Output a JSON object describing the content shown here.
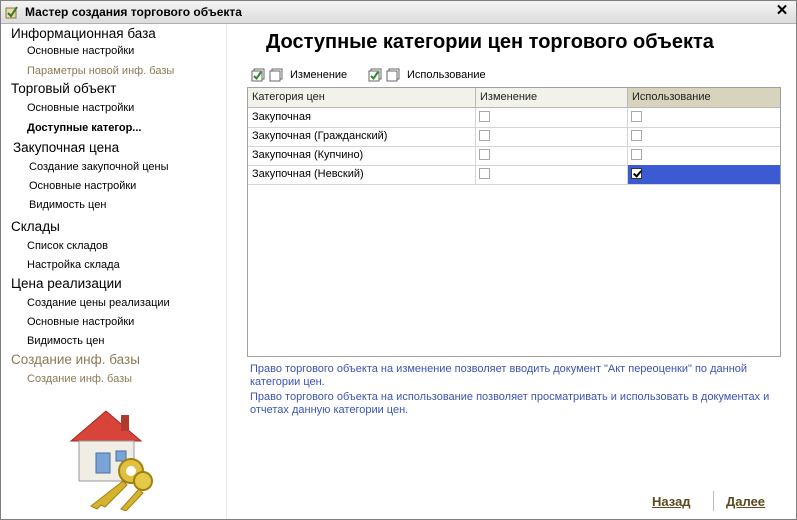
{
  "window": {
    "title": "Мастер создания торгового объекта"
  },
  "sidebar": {
    "sections": [
      {
        "label": "Информационная база",
        "muted": false,
        "items": [
          {
            "label": "Основные настройки",
            "muted": false,
            "current": false
          },
          {
            "label": "Параметры новой инф. базы",
            "muted": true,
            "current": false
          }
        ]
      },
      {
        "label": "Торговый объект",
        "muted": false,
        "items": [
          {
            "label": "Основные настройки",
            "muted": false,
            "current": false
          },
          {
            "label": "Доступные категор...",
            "muted": false,
            "current": true
          }
        ]
      },
      {
        "label": "Закупочная цена",
        "muted": false,
        "items": [
          {
            "label": "Создание закупочной цены",
            "muted": false,
            "current": false
          },
          {
            "label": "Основные настройки",
            "muted": false,
            "current": false
          },
          {
            "label": "Видимость цен",
            "muted": false,
            "current": false
          }
        ]
      },
      {
        "label": "Склады",
        "muted": false,
        "items": [
          {
            "label": "Список складов",
            "muted": false,
            "current": false
          },
          {
            "label": "Настройка склада",
            "muted": false,
            "current": false
          }
        ]
      },
      {
        "label": "Цена реализации",
        "muted": false,
        "items": [
          {
            "label": "Создание цены реализации",
            "muted": false,
            "current": false
          },
          {
            "label": "Основные настройки",
            "muted": false,
            "current": false
          },
          {
            "label": "Видимость цен",
            "muted": false,
            "current": false
          }
        ]
      },
      {
        "label": "Создание инф. базы",
        "muted": true,
        "items": [
          {
            "label": "Создание инф. базы",
            "muted": true,
            "current": false
          }
        ]
      }
    ]
  },
  "main": {
    "title": "Доступные категории цен торгового объекта",
    "toolbar": {
      "change_label": "Изменение",
      "use_label": "Использование"
    },
    "table": {
      "columns": [
        "Категория цен",
        "Изменение",
        "Использование"
      ],
      "rows": [
        {
          "category": "Закупочная",
          "change": false,
          "use": false,
          "selected": false
        },
        {
          "category": "Закупочная (Гражданский)",
          "change": false,
          "use": false,
          "selected": false
        },
        {
          "category": "Закупочная (Купчино)",
          "change": false,
          "use": false,
          "selected": false
        },
        {
          "category": "Закупочная (Невский)",
          "change": false,
          "use": true,
          "selected": true
        }
      ]
    },
    "help": [
      "Право торгового объекта на изменение позволяет вводить документ \"Акт переоценки\" по данной категории цен.",
      "Право торгового объекта на использование позволяет просматривать и использовать в документах и отчетах данную категории цен."
    ]
  },
  "footer": {
    "back_label": "Назад",
    "next_label": "Далее"
  },
  "colors": {
    "selection": "#3c5ad2",
    "help_text": "#3a54b4",
    "muted_text": "#8b7a55",
    "header_bg": "#f2f2ea"
  },
  "icons": [
    "app-icon",
    "close-icon",
    "check-all-icon",
    "uncheck-all-icon",
    "house-keys-logo"
  ]
}
